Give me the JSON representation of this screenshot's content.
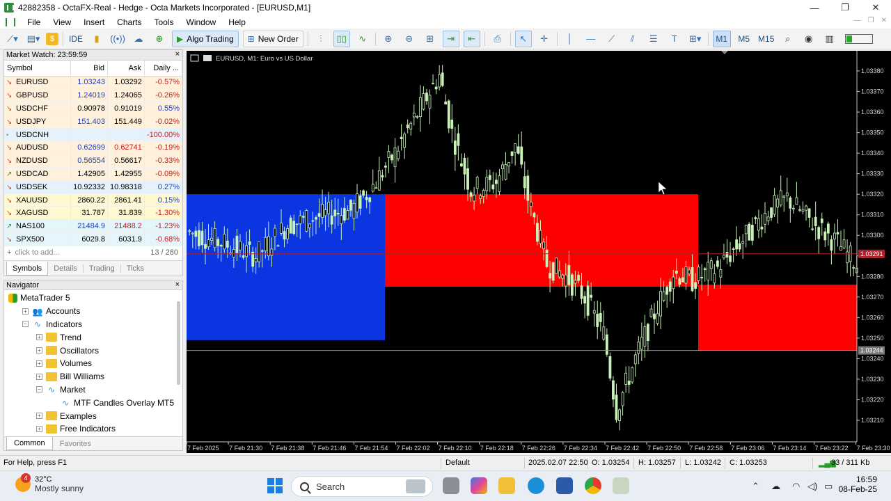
{
  "window": {
    "title": "42882358 - OctaFX-Real - Hedge - Octa Markets Incorporated - [EURUSD,M1]",
    "controls": [
      "—",
      "❐",
      "✕"
    ],
    "mdi_controls": [
      "—",
      "❐",
      "✕"
    ]
  },
  "menu": [
    "File",
    "View",
    "Insert",
    "Charts",
    "Tools",
    "Window",
    "Help"
  ],
  "toolbar": {
    "ide": "IDE",
    "algo_trading": "Algo Trading",
    "new_order": "New Order",
    "timeframes": [
      "M1",
      "M5",
      "M15"
    ],
    "selected_timeframe": "M1"
  },
  "market_watch": {
    "header": "Market Watch: 23:59:59",
    "close": "×",
    "columns": [
      "Symbol",
      "Bid",
      "Ask",
      "Daily ..."
    ],
    "rows": [
      {
        "symbol": "EURUSD",
        "bid": "1.03243",
        "ask": "1.03292",
        "daily": "-0.57%",
        "row": "r-orange",
        "dir": "↘",
        "bidc": "up",
        "askc": "",
        "dc": "dn"
      },
      {
        "symbol": "GBPUSD",
        "bid": "1.24019",
        "ask": "1.24065",
        "daily": "-0.26%",
        "row": "r-orange",
        "dir": "↘",
        "bidc": "up",
        "askc": "",
        "dc": "dn"
      },
      {
        "symbol": "USDCHF",
        "bid": "0.90978",
        "ask": "0.91019",
        "daily": "0.55%",
        "row": "r-orange",
        "dir": "↘",
        "bidc": "",
        "askc": "",
        "dc": "up"
      },
      {
        "symbol": "USDJPY",
        "bid": "151.403",
        "ask": "151.449",
        "daily": "-0.02%",
        "row": "r-orange",
        "dir": "↘",
        "bidc": "up",
        "askc": "",
        "dc": "dn"
      },
      {
        "symbol": "USDCNH",
        "bid": "",
        "ask": "",
        "daily": "-100.00%",
        "row": "r-blue",
        "dir": "•",
        "bidc": "",
        "askc": "",
        "dc": "dn"
      },
      {
        "symbol": "AUDUSD",
        "bid": "0.62699",
        "ask": "0.62741",
        "daily": "-0.19%",
        "row": "r-orange",
        "dir": "↘",
        "bidc": "up",
        "askc": "dn",
        "dc": "dn"
      },
      {
        "symbol": "NZDUSD",
        "bid": "0.56554",
        "ask": "0.56617",
        "daily": "-0.33%",
        "row": "r-orange",
        "dir": "↘",
        "bidc": "up",
        "askc": "",
        "dc": "dn"
      },
      {
        "symbol": "USDCAD",
        "bid": "1.42905",
        "ask": "1.42955",
        "daily": "-0.09%",
        "row": "r-orange",
        "dir": "↗",
        "bidc": "",
        "askc": "",
        "dc": "dn"
      },
      {
        "symbol": "USDSEK",
        "bid": "10.92332",
        "ask": "10.98318",
        "daily": "0.27%",
        "row": "r-blue",
        "dir": "↘",
        "bidc": "",
        "askc": "",
        "dc": "up"
      },
      {
        "symbol": "XAUUSD",
        "bid": "2860.22",
        "ask": "2861.41",
        "daily": "0.15%",
        "row": "r-yellow",
        "dir": "↘",
        "bidc": "",
        "askc": "",
        "dc": "up"
      },
      {
        "symbol": "XAGUSD",
        "bid": "31.787",
        "ask": "31.839",
        "daily": "-1.30%",
        "row": "r-yellow",
        "dir": "↘",
        "bidc": "",
        "askc": "",
        "dc": "dn"
      },
      {
        "symbol": "NAS100",
        "bid": "21484.9",
        "ask": "21488.2",
        "daily": "-1.23%",
        "row": "r-cyan",
        "dir": "↗",
        "bidc": "up",
        "askc": "dn",
        "dc": "dn"
      },
      {
        "symbol": "SPX500",
        "bid": "6029.8",
        "ask": "6031.9",
        "daily": "-0.68%",
        "row": "r-cyan",
        "dir": "↘",
        "bidc": "",
        "askc": "",
        "dc": "dn"
      }
    ],
    "add_placeholder": "click to add...",
    "count": "13 / 280",
    "tabs": [
      "Symbols",
      "Details",
      "Trading",
      "Ticks"
    ]
  },
  "navigator": {
    "header": "Navigator",
    "close": "×",
    "items": [
      {
        "label": "MetaTrader 5",
        "level": 0,
        "icon": "mt5-icon",
        "exp": ""
      },
      {
        "label": "Accounts",
        "level": 1,
        "icon": "accounts-icon",
        "exp": "+"
      },
      {
        "label": "Indicators",
        "level": 1,
        "icon": "indicator-icon",
        "exp": "−"
      },
      {
        "label": "Trend",
        "level": 2,
        "icon": "folder-icon",
        "exp": "+"
      },
      {
        "label": "Oscillators",
        "level": 2,
        "icon": "folder-icon",
        "exp": "+"
      },
      {
        "label": "Volumes",
        "level": 2,
        "icon": "folder-icon",
        "exp": "+"
      },
      {
        "label": "Bill Williams",
        "level": 2,
        "icon": "folder-icon",
        "exp": "+"
      },
      {
        "label": "Market",
        "level": 2,
        "icon": "indicator-icon",
        "exp": "−"
      },
      {
        "label": "MTF Candles Overlay MT5",
        "level": 3,
        "icon": "indicator-icon",
        "exp": ""
      },
      {
        "label": "Examples",
        "level": 2,
        "icon": "folder-icon",
        "exp": "+"
      },
      {
        "label": "Free Indicators",
        "level": 2,
        "icon": "folder-icon",
        "exp": "+"
      }
    ],
    "tabs": [
      "Common",
      "Favorites"
    ]
  },
  "chart": {
    "label": "EURUSD, M1:  Euro vs US Dollar",
    "price_labels": [
      "1.03380",
      "1.03370",
      "1.03360",
      "1.03350",
      "1.03340",
      "1.03330",
      "1.03320",
      "1.03310",
      "1.03300",
      "1.03290",
      "1.03280",
      "1.03270",
      "1.03260",
      "1.03250",
      "1.03240",
      "1.03230",
      "1.03220",
      "1.03210"
    ],
    "ask_tag": "1.03291",
    "bid_tag": "1.03244",
    "time_labels": [
      "7 Feb 2025",
      "7 Feb 21:30",
      "7 Feb 21:38",
      "7 Feb 21:46",
      "7 Feb 21:54",
      "7 Feb 22:02",
      "7 Feb 22:10",
      "7 Feb 22:18",
      "7 Feb 22:26",
      "7 Feb 22:34",
      "7 Feb 22:42",
      "7 Feb 22:50",
      "7 Feb 22:58",
      "7 Feb 23:06",
      "7 Feb 23:14",
      "7 Feb 23:22",
      "7 Feb 23:30"
    ],
    "colors": {
      "bg": "#000000",
      "candle": "#c9f2b8",
      "blue_box": "#0a35e0",
      "red_box": "#ff0000",
      "ask_line": "#b0202a",
      "bid_line": "#9a9a9a"
    }
  },
  "statusbar": {
    "help": "For Help, press F1",
    "profile": "Default",
    "datetime": "2025.02.07 22:50",
    "open": "O: 1.03254",
    "high": "H: 1.03257",
    "low": "L: 1.03242",
    "close": "C: 1.03253",
    "traffic": "33 / 311 Kb"
  },
  "taskbar": {
    "temp": "32°C",
    "weather": "Mostly sunny",
    "badge": "4",
    "search": "Search",
    "time": "16:59",
    "date": "08-Feb-25"
  }
}
